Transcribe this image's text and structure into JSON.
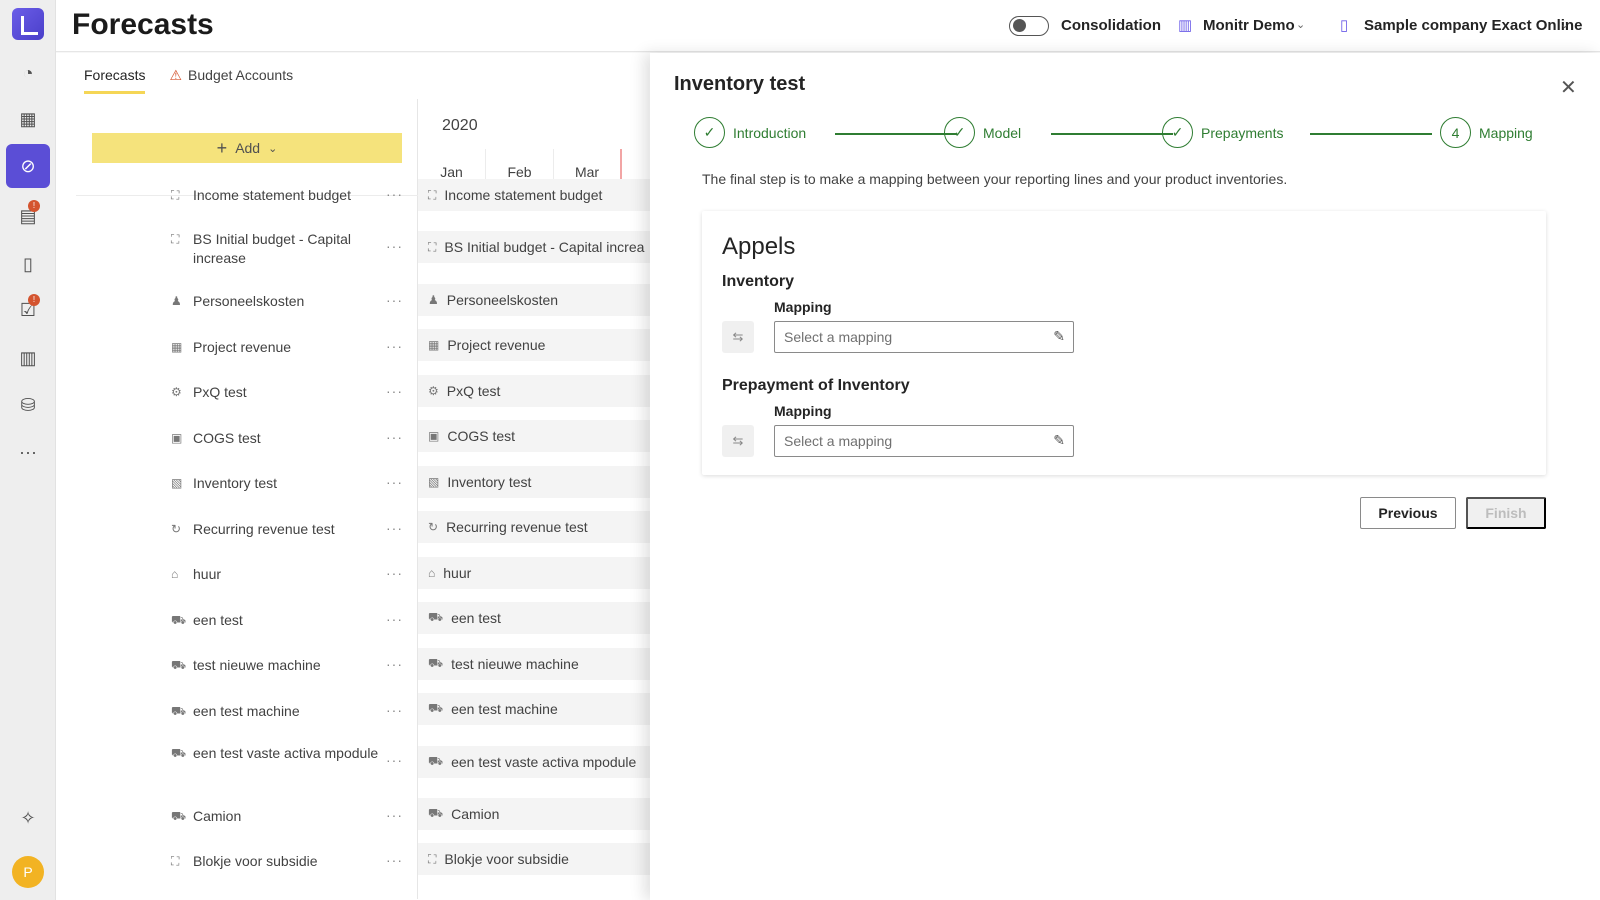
{
  "app": {
    "title": "Forecasts"
  },
  "header": {
    "consolidation_label": "Consolidation",
    "consolidation_on": false,
    "tenant": "Monitr Demo",
    "company": "Sample company Exact Online",
    "user_initial": "P"
  },
  "tabs": [
    {
      "label": "Forecasts",
      "active": true
    },
    {
      "label": "Budget Accounts",
      "warning": true
    }
  ],
  "toolbar": {
    "add_label": "Add"
  },
  "timeline": {
    "year": "2020",
    "months": [
      "Jan",
      "Feb",
      "Mar"
    ]
  },
  "rows": [
    {
      "label": "Income statement budget",
      "icon": "budget-icon"
    },
    {
      "label": "BS Initial budget - Capital increase",
      "right_label": "BS Initial budget - Capital increa",
      "icon": "budget-icon"
    },
    {
      "label": "Personeelskosten",
      "icon": "people-icon"
    },
    {
      "label": "Project revenue",
      "icon": "project-icon"
    },
    {
      "label": "PxQ test",
      "icon": "pxq-icon"
    },
    {
      "label": "COGS test",
      "icon": "cogs-icon"
    },
    {
      "label": "Inventory test",
      "icon": "inventory-icon"
    },
    {
      "label": "Recurring revenue test",
      "icon": "recurring-icon"
    },
    {
      "label": "huur",
      "icon": "rent-icon"
    },
    {
      "label": "een test",
      "icon": "asset-icon"
    },
    {
      "label": "test nieuwe machine",
      "icon": "asset-icon"
    },
    {
      "label": "een test machine",
      "icon": "asset-icon"
    },
    {
      "label": "een test vaste activa mpodule",
      "icon": "asset-icon"
    },
    {
      "label": "Camion",
      "icon": "asset-icon"
    },
    {
      "label": "Blokje voor subsidie",
      "icon": "budget-icon"
    }
  ],
  "panel": {
    "title": "Inventory test",
    "steps": [
      {
        "label": "Introduction",
        "done": true
      },
      {
        "label": "Model",
        "done": true
      },
      {
        "label": "Prepayments",
        "done": true
      },
      {
        "label": "Mapping",
        "number": "4",
        "current": true
      }
    ],
    "intro": "The final step is to make a mapping between your reporting lines and your product inventories.",
    "card": {
      "title": "Appels",
      "sections": [
        {
          "title": "Inventory",
          "mapping_label": "Mapping",
          "placeholder": "Select a mapping"
        },
        {
          "title": "Prepayment of Inventory",
          "mapping_label": "Mapping",
          "placeholder": "Select a mapping"
        }
      ]
    },
    "buttons": {
      "previous": "Previous",
      "finish": "Finish"
    }
  },
  "colors": {
    "accent": "#5b4ed6",
    "step_green": "#2f7d32",
    "add_button": "#f5e37c",
    "badge": "#d4542f"
  }
}
